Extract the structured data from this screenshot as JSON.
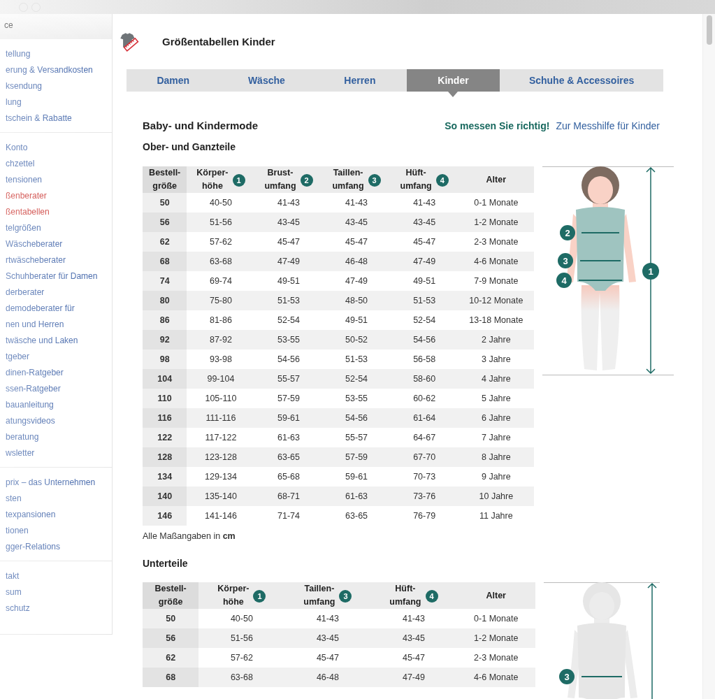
{
  "sidebar": {
    "header": "ce",
    "groups": [
      [
        {
          "label": "tellung",
          "selected": false
        },
        {
          "label": "erung & Versandkosten",
          "selected": false
        },
        {
          "label": "ksendung",
          "selected": false
        },
        {
          "label": "lung",
          "selected": false
        },
        {
          "label": "tschein & Rabatte",
          "selected": false
        }
      ],
      [
        {
          "label": "Konto",
          "selected": false
        },
        {
          "label": "chzettel",
          "selected": false
        },
        {
          "label": "tensionen",
          "selected": false
        },
        {
          "label": "ßenberater",
          "selected": true
        },
        {
          "label": "ßentabellen",
          "selected": true
        },
        {
          "label": "telgrößen",
          "selected": false
        },
        {
          "label": "Wäscheberater",
          "selected": false
        },
        {
          "label": "rtwäscheberater",
          "selected": false
        },
        {
          "label": "Schuhberater für Damen",
          "selected": false
        },
        {
          "label": "derberater",
          "selected": false
        },
        {
          "label": "demodeberater für\nnen und Herren",
          "selected": false
        },
        {
          "label": "twäsche und Laken\ntgeber",
          "selected": false
        },
        {
          "label": "dinen-Ratgeber",
          "selected": false
        },
        {
          "label": "ssen-Ratgeber",
          "selected": false
        },
        {
          "label": "bauanleitung",
          "selected": false
        },
        {
          "label": "atungsvideos",
          "selected": false
        },
        {
          "label": "beratung",
          "selected": false
        },
        {
          "label": "wsletter",
          "selected": false
        }
      ],
      [
        {
          "label": "prix – das Unternehmen",
          "selected": false
        },
        {
          "label": "sten",
          "selected": false
        },
        {
          "label": "texpansionen",
          "selected": false
        },
        {
          "label": "tionen",
          "selected": false
        },
        {
          "label": "gger-Relations",
          "selected": false
        }
      ],
      [
        {
          "label": "takt",
          "selected": false
        },
        {
          "label": "sum",
          "selected": false
        },
        {
          "label": "schutz",
          "selected": false
        }
      ]
    ]
  },
  "page": {
    "title": "Größentabellen Kinder"
  },
  "tabs": [
    {
      "label": "Damen",
      "selected": false
    },
    {
      "label": "Wäsche",
      "selected": false
    },
    {
      "label": "Herren",
      "selected": false
    },
    {
      "label": "Kinder",
      "selected": true
    },
    {
      "label": "Schuhe & Accessoires",
      "selected": false
    }
  ],
  "section": {
    "title": "Baby- und Kindermode",
    "help_label": "So messen Sie richtig!",
    "help_link": "Zur Messhilfe für Kinder"
  },
  "tables": [
    {
      "title": "Ober- und Ganzteile",
      "faded": false,
      "columns": [
        {
          "label": "Bestell-\ngröße"
        },
        {
          "label": "Körper-\nhöhe",
          "badge": "1"
        },
        {
          "label": "Brust-\numfang",
          "badge": "2"
        },
        {
          "label": "Taillen-\numfang",
          "badge": "3"
        },
        {
          "label": "Hüft-\numfang",
          "badge": "4"
        },
        {
          "label": "Alter"
        }
      ],
      "rows": [
        [
          "50",
          "40-50",
          "41-43",
          "41-43",
          "41-43",
          "0-1 Monate"
        ],
        [
          "56",
          "51-56",
          "43-45",
          "43-45",
          "43-45",
          "1-2 Monate"
        ],
        [
          "62",
          "57-62",
          "45-47",
          "45-47",
          "45-47",
          "2-3 Monate"
        ],
        [
          "68",
          "63-68",
          "47-49",
          "46-48",
          "47-49",
          "4-6 Monate"
        ],
        [
          "74",
          "69-74",
          "49-51",
          "47-49",
          "49-51",
          "7-9 Monate"
        ],
        [
          "80",
          "75-80",
          "51-53",
          "48-50",
          "51-53",
          "10-12 Monate"
        ],
        [
          "86",
          "81-86",
          "52-54",
          "49-51",
          "52-54",
          "13-18 Monate"
        ],
        [
          "92",
          "87-92",
          "53-55",
          "50-52",
          "54-56",
          "2 Jahre"
        ],
        [
          "98",
          "93-98",
          "54-56",
          "51-53",
          "56-58",
          "3 Jahre"
        ],
        [
          "104",
          "99-104",
          "55-57",
          "52-54",
          "58-60",
          "4 Jahre"
        ],
        [
          "110",
          "105-110",
          "57-59",
          "53-55",
          "60-62",
          "5 Jahre"
        ],
        [
          "116",
          "111-116",
          "59-61",
          "54-56",
          "61-64",
          "6 Jahre"
        ],
        [
          "122",
          "117-122",
          "61-63",
          "55-57",
          "64-67",
          "7 Jahre"
        ],
        [
          "128",
          "123-128",
          "63-65",
          "57-59",
          "67-70",
          "8 Jahre"
        ],
        [
          "134",
          "129-134",
          "65-68",
          "59-61",
          "70-73",
          "9 Jahre"
        ],
        [
          "140",
          "135-140",
          "68-71",
          "61-63",
          "73-76",
          "10 Jahre"
        ],
        [
          "146",
          "141-146",
          "71-74",
          "63-65",
          "76-79",
          "11 Jahre"
        ]
      ],
      "note": "Alle Maßangaben in **cm**",
      "figure": {
        "height_badge": "1",
        "girth_badges": [
          {
            "label": "2",
            "kind": "chest"
          },
          {
            "label": "3",
            "kind": "waist"
          },
          {
            "label": "4",
            "kind": "hip"
          }
        ]
      }
    },
    {
      "title": "Unterteile",
      "faded": true,
      "columns": [
        {
          "label": "Bestell-\ngröße"
        },
        {
          "label": "Körper-\nhöhe",
          "badge": "1"
        },
        {
          "label": "Taillen-\numfang",
          "badge": "3"
        },
        {
          "label": "Hüft-\numfang",
          "badge": "4"
        },
        {
          "label": "Alter"
        }
      ],
      "rows": [
        [
          "50",
          "40-50",
          "41-43",
          "41-43",
          "0-1 Monate"
        ],
        [
          "56",
          "51-56",
          "43-45",
          "43-45",
          "1-2 Monate"
        ],
        [
          "62",
          "57-62",
          "45-47",
          "45-47",
          "2-3 Monate"
        ],
        [
          "68",
          "63-68",
          "46-48",
          "47-49",
          "4-6 Monate"
        ]
      ],
      "figure": {
        "girth_badges": [
          {
            "label": "3",
            "kind": "waist"
          }
        ]
      }
    }
  ]
}
